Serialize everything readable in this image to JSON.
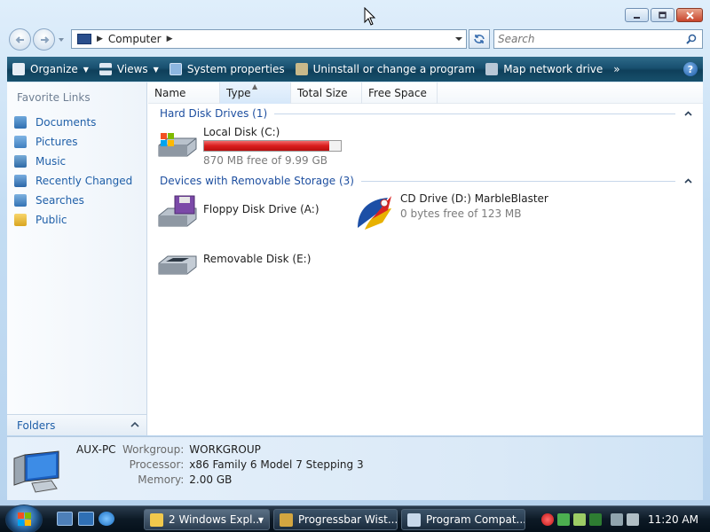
{
  "window": {
    "address": {
      "location": "Computer"
    },
    "search": {
      "placeholder": "Search"
    }
  },
  "commands": [
    {
      "label": "Organize",
      "icon": "organize-icon",
      "dropdown": true
    },
    {
      "label": "Views",
      "icon": "views-icon",
      "dropdown": true
    },
    {
      "label": "System properties",
      "icon": "system-properties-icon"
    },
    {
      "label": "Uninstall or change a program",
      "icon": "uninstall-icon"
    },
    {
      "label": "Map network drive",
      "icon": "map-drive-icon"
    },
    {
      "label": "»",
      "icon": "more-icon"
    }
  ],
  "help": {
    "label": "?"
  },
  "sidebar": {
    "title": "Favorite Links",
    "items": [
      {
        "label": "Documents",
        "icon": "documents-icon"
      },
      {
        "label": "Pictures",
        "icon": "pictures-icon"
      },
      {
        "label": "Music",
        "icon": "music-icon"
      },
      {
        "label": "Recently Changed",
        "icon": "recently-changed-icon"
      },
      {
        "label": "Searches",
        "icon": "searches-icon"
      },
      {
        "label": "Public",
        "icon": "public-icon"
      }
    ],
    "folders_label": "Folders"
  },
  "columns": [
    "Name",
    "Type",
    "Total Size",
    "Free Space"
  ],
  "groups": {
    "hdd": {
      "title": "Hard Disk Drives (1)",
      "drives": [
        {
          "name": "Local Disk (C:)",
          "free_text": "870 MB free of 9.99 GB",
          "used_fraction": 0.915
        }
      ]
    },
    "removable": {
      "title": "Devices with Removable Storage (3)",
      "drives": [
        {
          "name": "Floppy Disk Drive (A:)"
        },
        {
          "name": "CD Drive (D:) MarbleBlaster",
          "free_text": "0 bytes free of 123 MB"
        },
        {
          "name": "Removable Disk (E:)"
        }
      ]
    }
  },
  "details": {
    "computer_name": "AUX-PC",
    "rows": [
      {
        "label": "Workgroup:",
        "value": "WORKGROUP"
      },
      {
        "label": "Processor:",
        "value": "x86 Family 6 Model 7 Stepping 3"
      },
      {
        "label": "Memory:",
        "value": "2.00 GB"
      }
    ]
  },
  "taskbar": {
    "tasks": [
      {
        "label": "2 Windows Expl...",
        "active": true
      },
      {
        "label": "Progressbar Wist..."
      },
      {
        "label": "Program Compat..."
      }
    ],
    "clock": "11:20 AM"
  },
  "colors": {
    "accent": "#1e4fa0",
    "link": "#1f5fa8",
    "progress": "#d91c1c",
    "command_bar": "#18506f"
  }
}
